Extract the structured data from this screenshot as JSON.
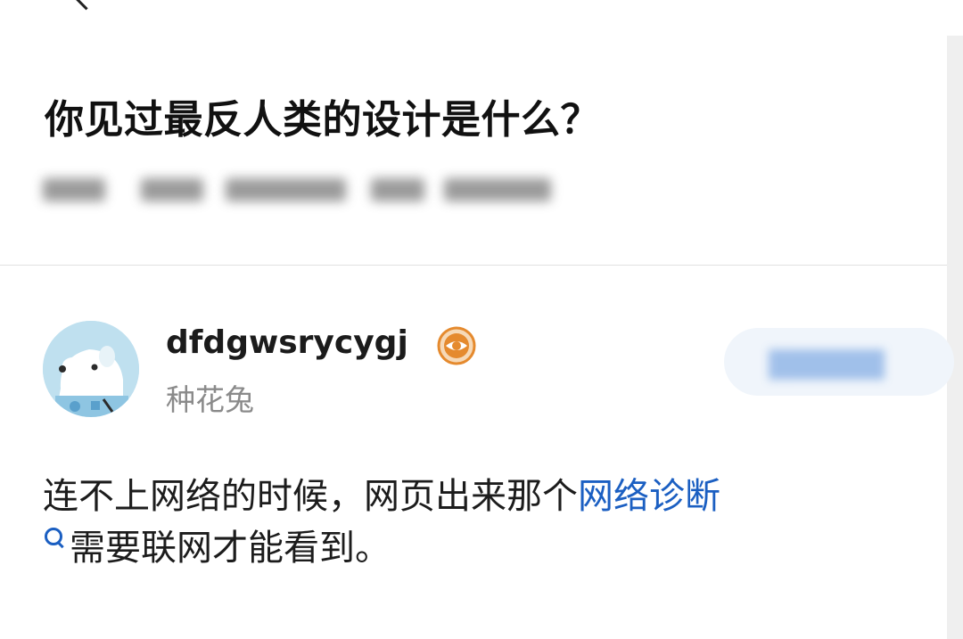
{
  "question": {
    "title": "你见过最反人类的设计是什么？"
  },
  "answer": {
    "author": {
      "name": "dfdgwsrycygj",
      "description": "种花兔"
    },
    "text_before_link": "连不上网络的时候，网页出来那个",
    "link_text": "网络诊断",
    "text_after_link": "需要联网才能看到。"
  },
  "icons": {
    "back": "chevron-left-icon",
    "badge": "eye-badge-icon",
    "search": "search-icon",
    "avatar": "polar-bear-avatar"
  },
  "colors": {
    "link": "#1b5fc2",
    "secondary_text": "#8a8a8a",
    "badge": "#e58a2e"
  }
}
